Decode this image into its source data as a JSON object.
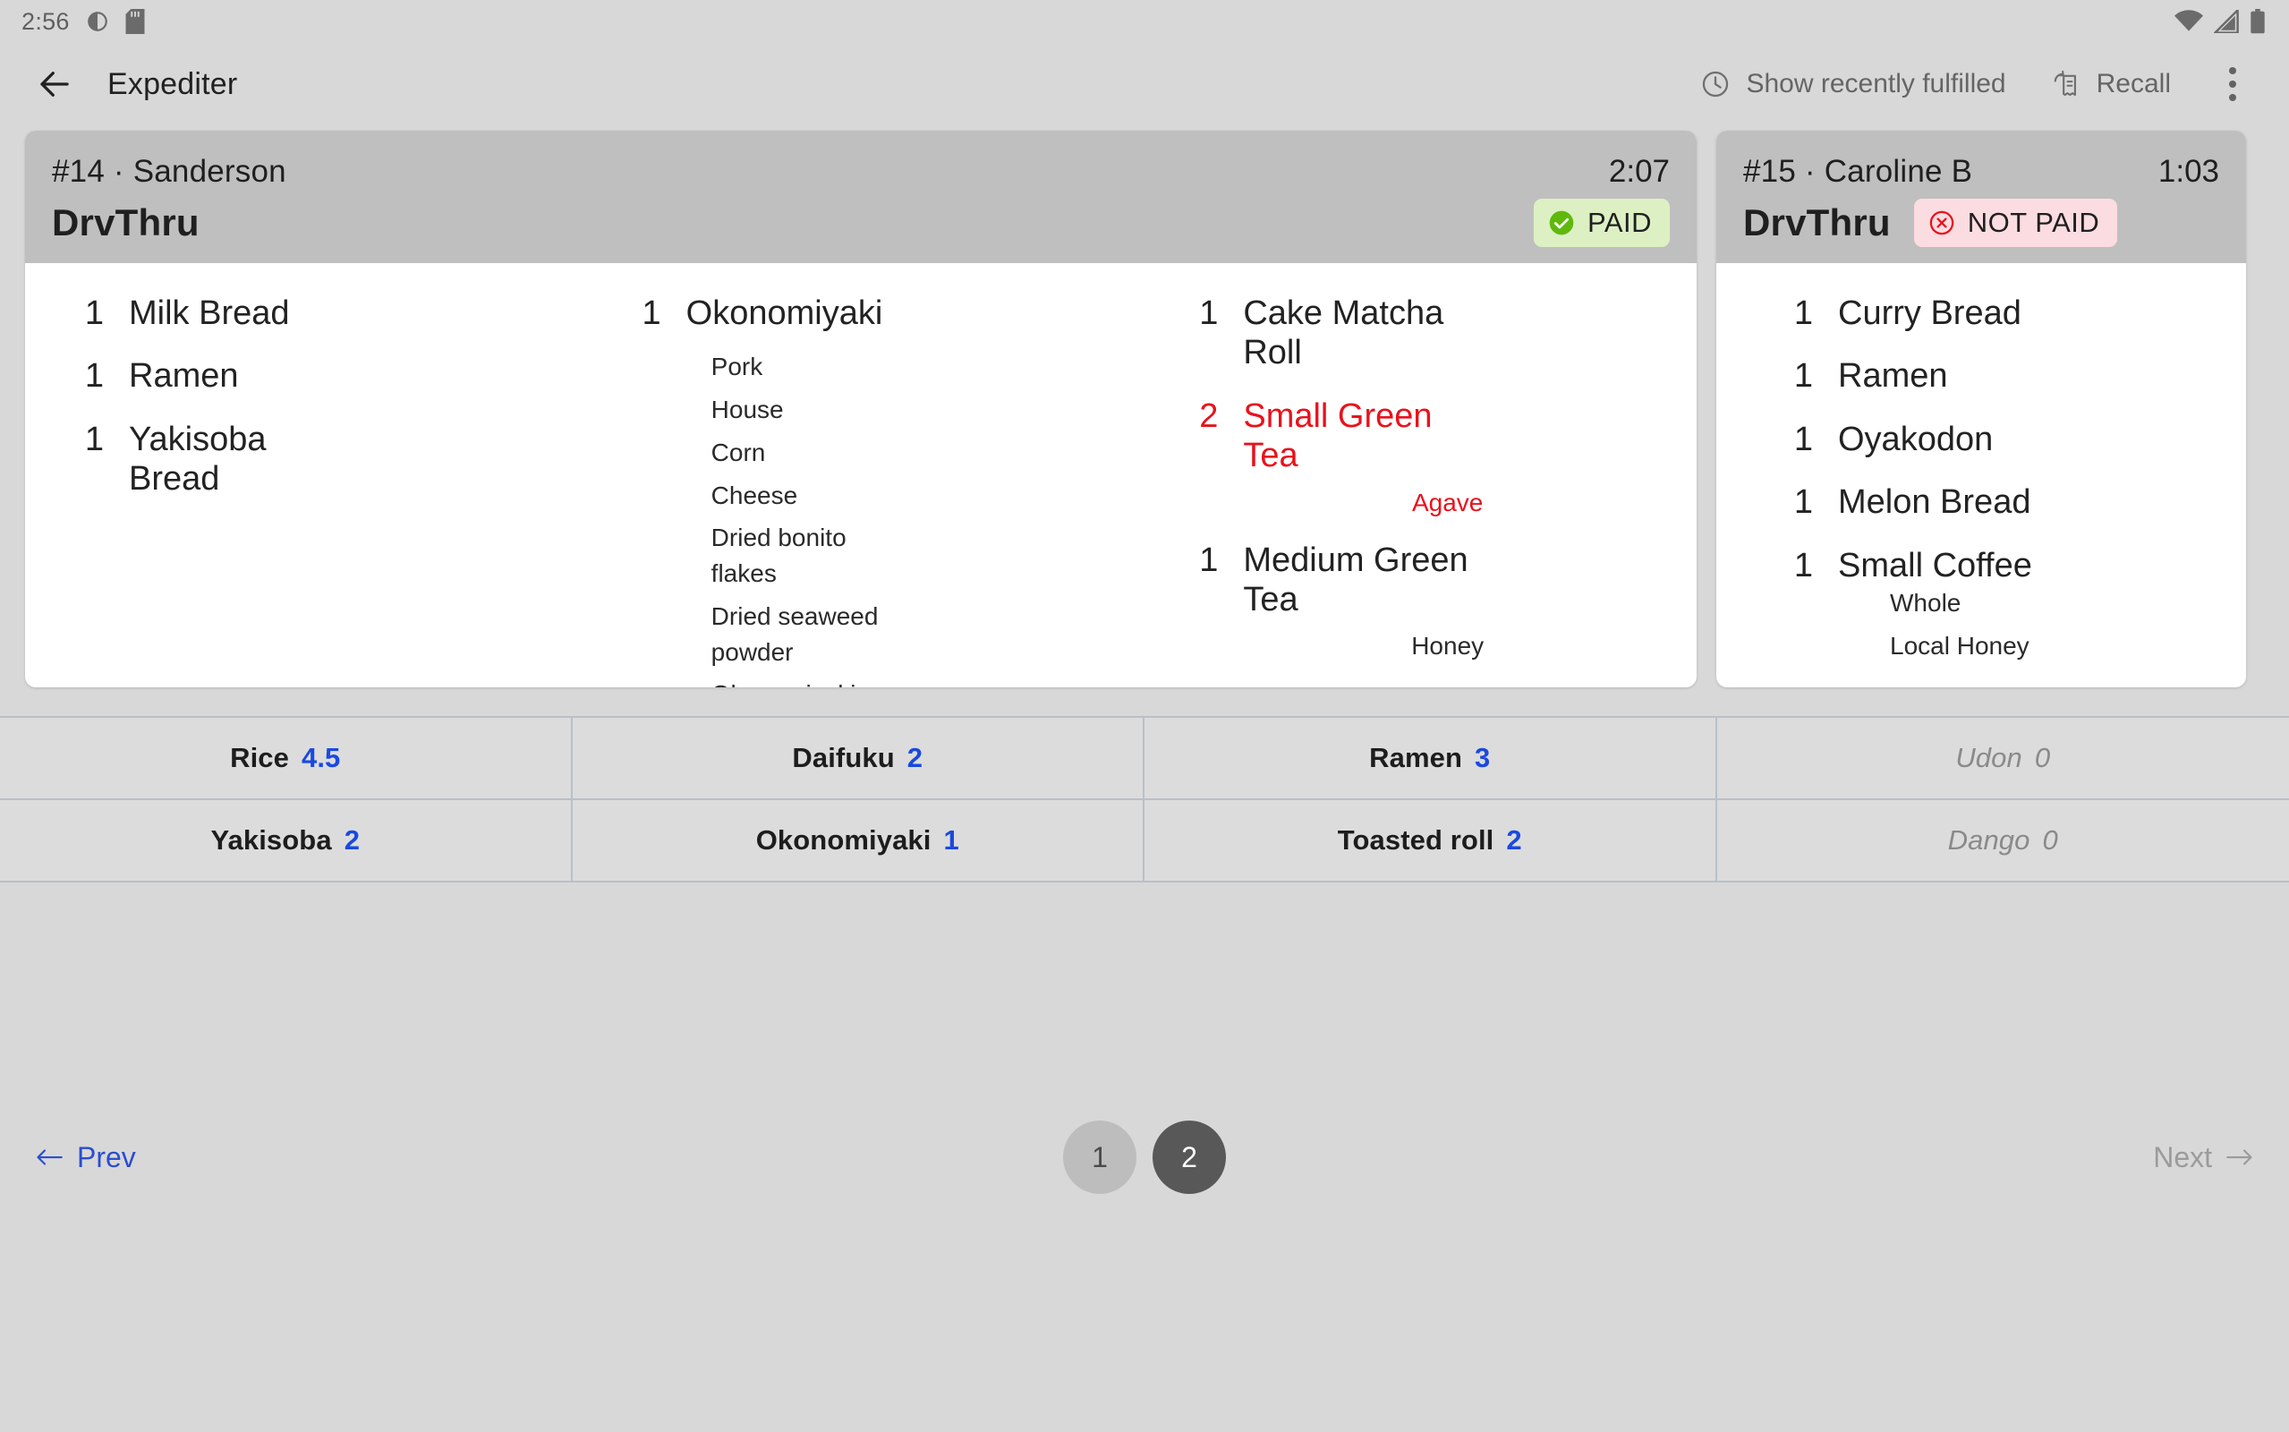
{
  "status_bar": {
    "time": "2:56",
    "left_icons": [
      "do-not-disturb-icon",
      "sd-card-icon"
    ],
    "right_icons": [
      "wifi-icon",
      "cellular-signal-icon",
      "battery-icon"
    ]
  },
  "app_bar": {
    "back_icon": "back-arrow-icon",
    "title": "Expediter",
    "show_recently_fulfilled": "Show recently fulfilled",
    "show_recently_fulfilled_icon": "clock-icon",
    "recall": "Recall",
    "recall_icon": "receipt-undo-icon",
    "overflow_icon": "more-vertical-icon"
  },
  "orders": [
    {
      "order_id": "#14 · Sanderson",
      "timer": "2:07",
      "destination": "DrvThru",
      "payment_status": "PAID",
      "payment_icon": "check-circle-icon",
      "columns": [
        {
          "items": [
            {
              "qty": "1",
              "name": "Milk Bread",
              "mods": []
            },
            {
              "qty": "1",
              "name": "Ramen",
              "mods": []
            },
            {
              "qty": "1",
              "name": "Yakisoba Bread",
              "mods": []
            }
          ]
        },
        {
          "items": [
            {
              "qty": "1",
              "name": "Okonomiyaki",
              "mods": [
                "Pork",
                "House",
                "Corn",
                "Cheese",
                "Dried bonito flakes",
                "Dried seaweed powder",
                "Okonomiyaki Sauce"
              ]
            }
          ]
        },
        {
          "items": [
            {
              "qty": "1",
              "name": "Cake Matcha Roll",
              "mods": []
            },
            {
              "qty": "2",
              "name": "Small Green Tea",
              "mods": [
                "Agave"
              ],
              "highlight": true
            },
            {
              "qty": "1",
              "name": "Medium Green Tea",
              "mods": [
                "Honey"
              ]
            }
          ]
        }
      ]
    },
    {
      "order_id": "#15 · Caroline B",
      "timer": "1:03",
      "destination": "DrvThru",
      "payment_status": "NOT PAID",
      "payment_icon": "cancel-circle-icon",
      "columns": [
        {
          "items": [
            {
              "qty": "1",
              "name": "Curry Bread",
              "mods": []
            },
            {
              "qty": "1",
              "name": "Ramen",
              "mods": []
            },
            {
              "qty": "1",
              "name": "Oyakodon",
              "mods": []
            },
            {
              "qty": "1",
              "name": "Melon Bread",
              "mods": []
            },
            {
              "qty": "1",
              "name": "Small Coffee",
              "mods": [
                "Whole",
                "Local Honey"
              ]
            }
          ]
        }
      ]
    }
  ],
  "summary": [
    {
      "label": "Rice",
      "count": "4.5",
      "zero": false
    },
    {
      "label": "Daifuku",
      "count": "2",
      "zero": false
    },
    {
      "label": "Ramen",
      "count": "3",
      "zero": false
    },
    {
      "label": "Udon",
      "count": "0",
      "zero": true
    },
    {
      "label": "Yakisoba",
      "count": "2",
      "zero": false
    },
    {
      "label": "Okonomiyaki",
      "count": "1",
      "zero": false
    },
    {
      "label": "Toasted roll",
      "count": "2",
      "zero": false
    },
    {
      "label": "Dango",
      "count": "0",
      "zero": true
    }
  ],
  "pagination": {
    "prev_label": "Prev",
    "prev_icon": "arrow-left-icon",
    "next_label": "Next",
    "next_icon": "arrow-right-icon",
    "pages": [
      "1",
      "2"
    ],
    "active_page": "2"
  },
  "colors": {
    "paid_bg": "#ddf0c4",
    "paid_icon": "#5fb90c",
    "notpaid_bg": "#fbdce1",
    "notpaid_icon": "#e8121c",
    "highlight": "#e8121c",
    "count_blue": "#1a49e0",
    "link_blue": "#2a4ed0"
  }
}
